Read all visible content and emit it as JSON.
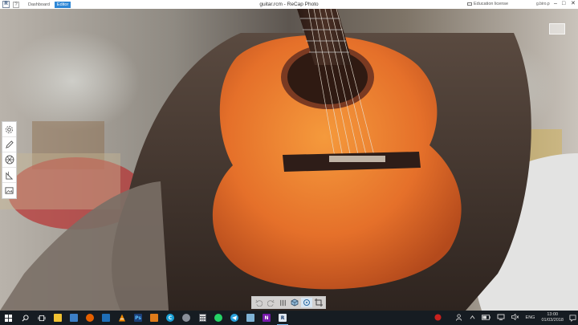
{
  "window": {
    "app_icon": "R",
    "help": "?",
    "tabs": [
      {
        "label": "Dashboard",
        "active": false
      },
      {
        "label": "Editor",
        "active": true
      }
    ],
    "title": "guitar.rcm - ReCap Photo",
    "license": "Education license",
    "user": "g.biro.p",
    "controls": [
      "–",
      "□",
      "✕"
    ]
  },
  "viewport": {
    "nav_cube_label": "",
    "left_tools": [
      {
        "icon": "gear-icon"
      },
      {
        "icon": "pencil-icon"
      },
      {
        "icon": "mesh-icon"
      },
      {
        "icon": "measure-icon"
      },
      {
        "icon": "image-icon"
      }
    ],
    "view_tools": [
      {
        "icon": "undo-icon",
        "state": "dim"
      },
      {
        "icon": "redo-icon",
        "state": "dim"
      },
      {
        "icon": "grid-icon",
        "state": "normal"
      },
      {
        "icon": "cube-view-icon",
        "state": "normal"
      },
      {
        "icon": "orbit-icon",
        "state": "active"
      },
      {
        "icon": "crop-icon",
        "state": "normal"
      }
    ]
  },
  "taskbar": {
    "apps": [
      {
        "icon": "windows-start-icon"
      },
      {
        "icon": "search-icon"
      },
      {
        "icon": "task-view-icon"
      },
      {
        "icon": "file-explorer-icon",
        "color": "#f1c232"
      },
      {
        "icon": "store-icon",
        "color": "#3c7fc7"
      },
      {
        "icon": "firefox-icon",
        "color": "#e66000"
      },
      {
        "icon": "app-blue-icon",
        "color": "#1f6fb8"
      },
      {
        "icon": "vlc-icon",
        "color": "#f08a00"
      },
      {
        "icon": "photoshop-icon",
        "color": "#1c3f78",
        "letter": "Ps"
      },
      {
        "icon": "app-orange-icon",
        "color": "#e07b1a"
      },
      {
        "icon": "ccleaner-icon",
        "color": "#1aa1d6",
        "letter": "C"
      },
      {
        "icon": "app-sphere-icon",
        "color": "#8a8f99"
      },
      {
        "icon": "calculator-icon",
        "color": "#555a62"
      },
      {
        "icon": "whatsapp-icon",
        "color": "#25d366"
      },
      {
        "icon": "telegram-icon",
        "color": "#2aa3de"
      },
      {
        "icon": "app-cube-icon",
        "color": "#7fb3d5"
      },
      {
        "icon": "onenote-icon",
        "color": "#7719aa",
        "letter": "N"
      },
      {
        "icon": "recap-icon",
        "color": "#dfe6ee",
        "letter": "R",
        "active": true
      }
    ],
    "tray": {
      "language": "ENG",
      "time": "13:00",
      "date": "01/03/2018"
    }
  }
}
